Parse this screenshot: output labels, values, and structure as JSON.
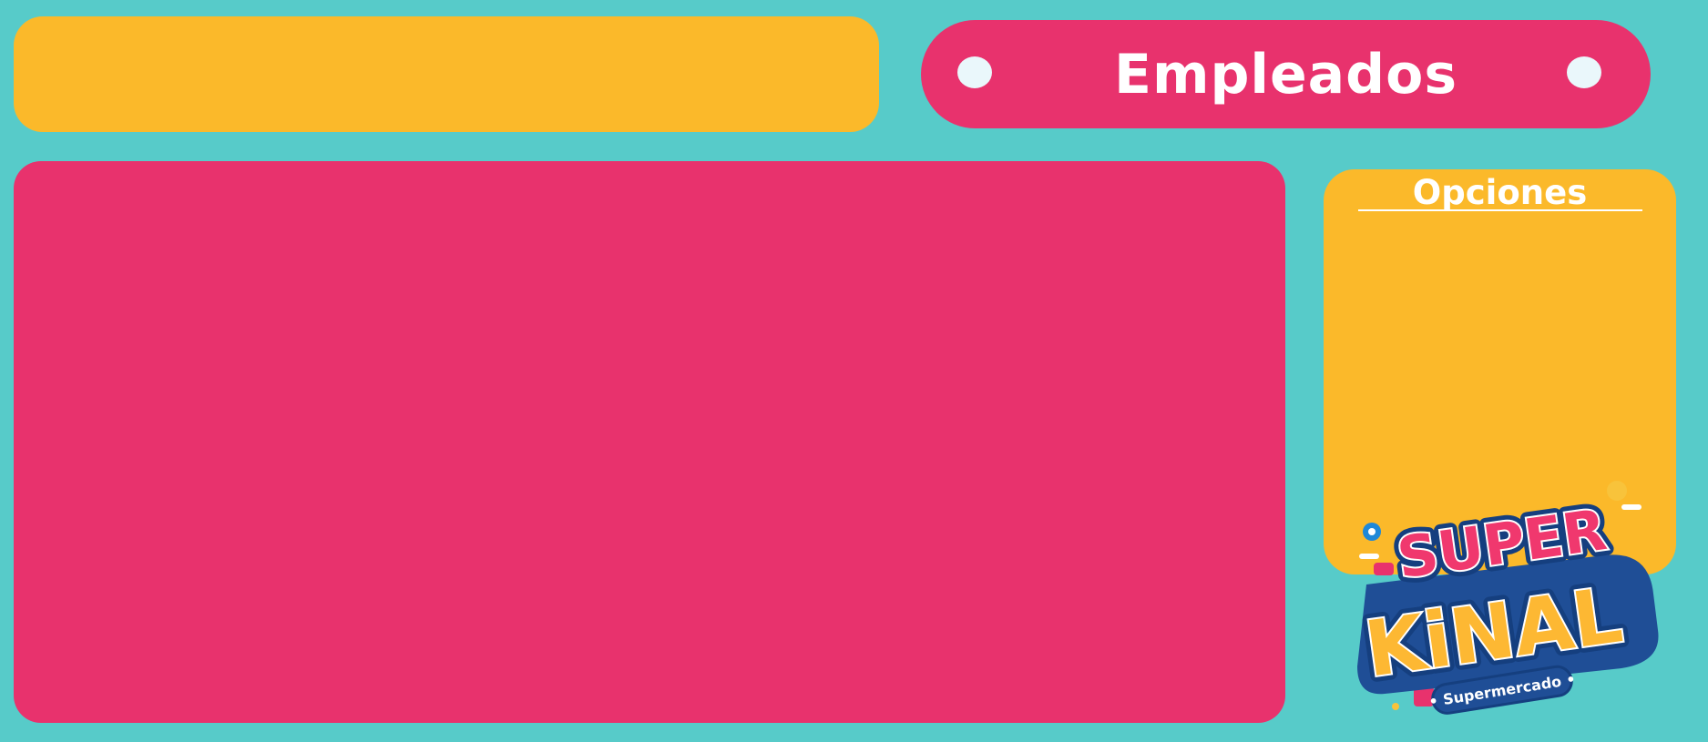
{
  "header": {
    "title": "Empleados"
  },
  "options": {
    "title": "Opciones"
  },
  "logo": {
    "line1": "SUPER",
    "line2": "KiNAL",
    "tagline": "• Supermercado •"
  },
  "colors": {
    "background": "#57CBC9",
    "accent_pink": "#E8326D",
    "accent_yellow": "#FBB92A",
    "logo_blue": "#1F4E96"
  }
}
